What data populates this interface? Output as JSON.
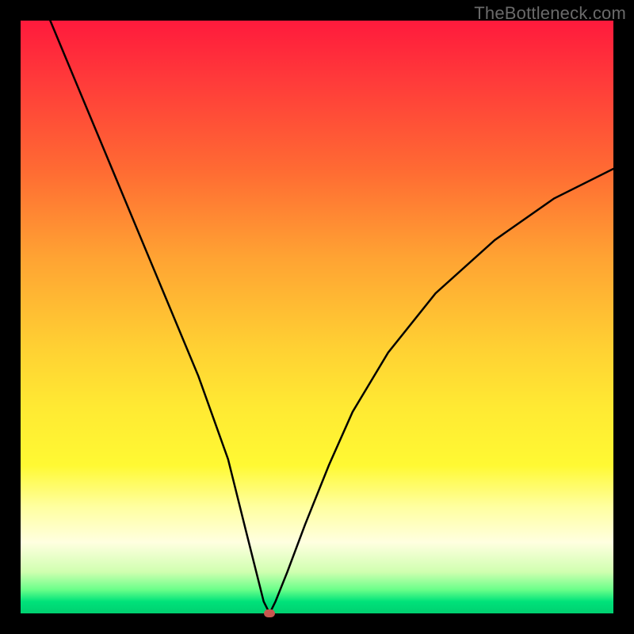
{
  "watermark": "TheBottleneck.com",
  "chart_data": {
    "type": "line",
    "title": "",
    "xlabel": "",
    "ylabel": "",
    "xlim": [
      0,
      100
    ],
    "ylim": [
      0,
      100
    ],
    "series": [
      {
        "name": "bottleneck-curve",
        "x": [
          5,
          10,
          15,
          20,
          25,
          30,
          35,
          38,
          40,
          41,
          42,
          43,
          45,
          48,
          52,
          56,
          62,
          70,
          80,
          90,
          100
        ],
        "values": [
          100,
          88,
          76,
          64,
          52,
          40,
          26,
          14,
          6,
          2,
          0,
          2,
          7,
          15,
          25,
          34,
          44,
          54,
          63,
          70,
          75
        ]
      }
    ],
    "marker": {
      "x": 42,
      "y": 0,
      "color": "#c7574f"
    },
    "gradient_stops": [
      {
        "pos": 0,
        "color": "#ff1a3c"
      },
      {
        "pos": 25,
        "color": "#ff6a33"
      },
      {
        "pos": 55,
        "color": "#ffd033"
      },
      {
        "pos": 82,
        "color": "#ffffa0"
      },
      {
        "pos": 96,
        "color": "#6aff8a"
      },
      {
        "pos": 100,
        "color": "#00d070"
      }
    ]
  }
}
